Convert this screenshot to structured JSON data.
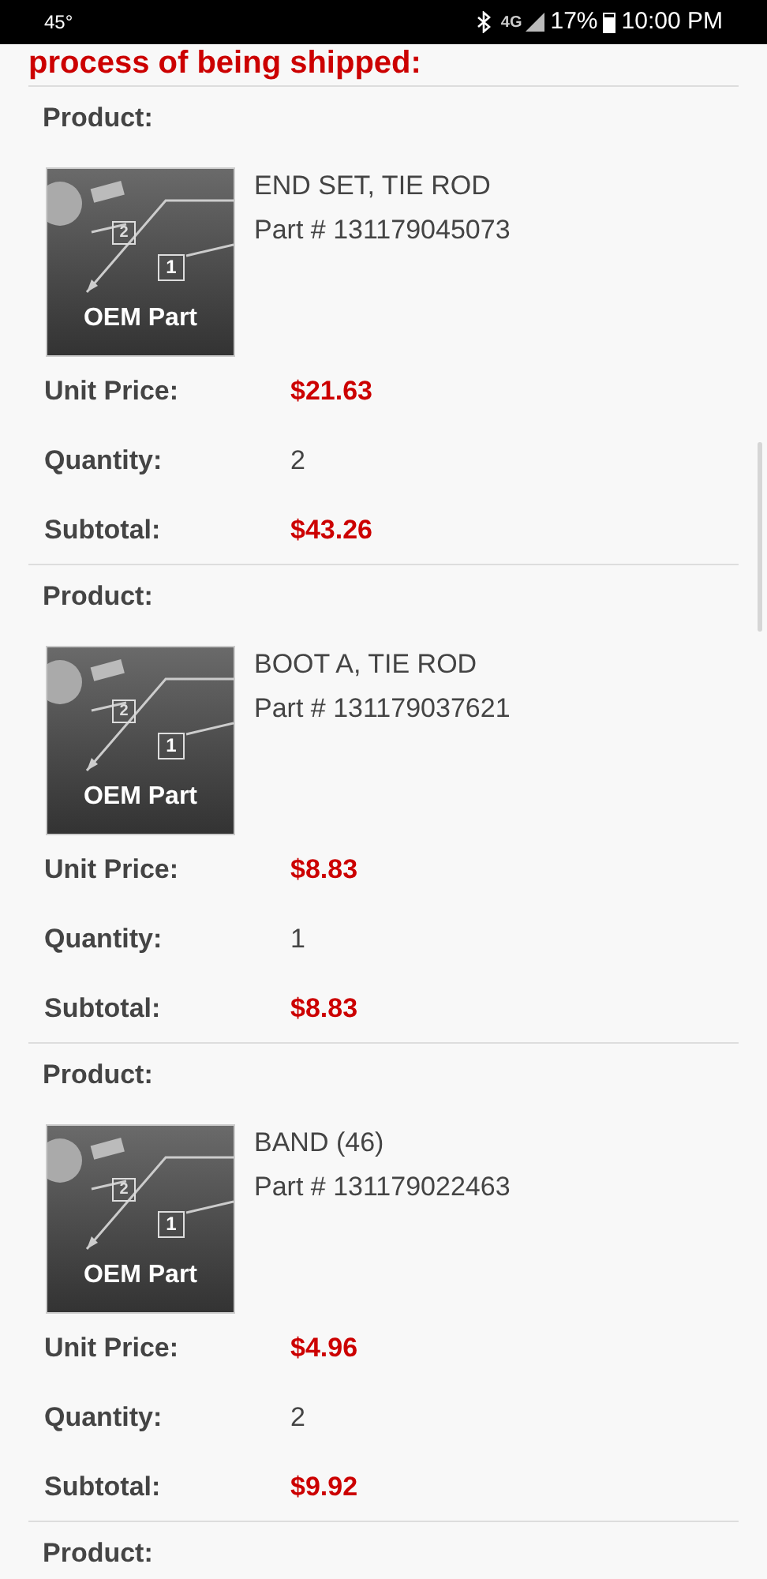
{
  "status_bar": {
    "temperature": "45°",
    "network": "4G",
    "battery": "17%",
    "time": "10:00 PM"
  },
  "heading": "process of being shipped:",
  "items": [
    {
      "product_label": "Product:",
      "image": {
        "label": "OEM Part",
        "callouts": [
          "2",
          "1"
        ]
      },
      "name": "END SET, TIE ROD",
      "part": "Part # 131179045073",
      "fields": [
        {
          "label": "Unit Price:",
          "value": "$21.63",
          "kind": "price"
        },
        {
          "label": "Quantity:",
          "value": "2",
          "kind": "plain"
        },
        {
          "label": "Subtotal:",
          "value": "$43.26",
          "kind": "price"
        }
      ]
    },
    {
      "product_label": "Product:",
      "image": {
        "label": "OEM Part",
        "callouts": [
          "2",
          "1"
        ]
      },
      "name": "BOOT A, TIE ROD",
      "part": "Part # 131179037621",
      "fields": [
        {
          "label": "Unit Price:",
          "value": "$8.83",
          "kind": "price"
        },
        {
          "label": "Quantity:",
          "value": "1",
          "kind": "plain"
        },
        {
          "label": "Subtotal:",
          "value": "$8.83",
          "kind": "price"
        }
      ]
    },
    {
      "product_label": "Product:",
      "image": {
        "label": "OEM Part",
        "callouts": [
          "2",
          "1"
        ]
      },
      "name": "BAND (46)",
      "part": "Part # 131179022463",
      "fields": [
        {
          "label": "Unit Price:",
          "value": "$4.96",
          "kind": "price"
        },
        {
          "label": "Quantity:",
          "value": "2",
          "kind": "plain"
        },
        {
          "label": "Subtotal:",
          "value": "$9.92",
          "kind": "price"
        }
      ]
    },
    {
      "product_label": "Product:"
    }
  ]
}
